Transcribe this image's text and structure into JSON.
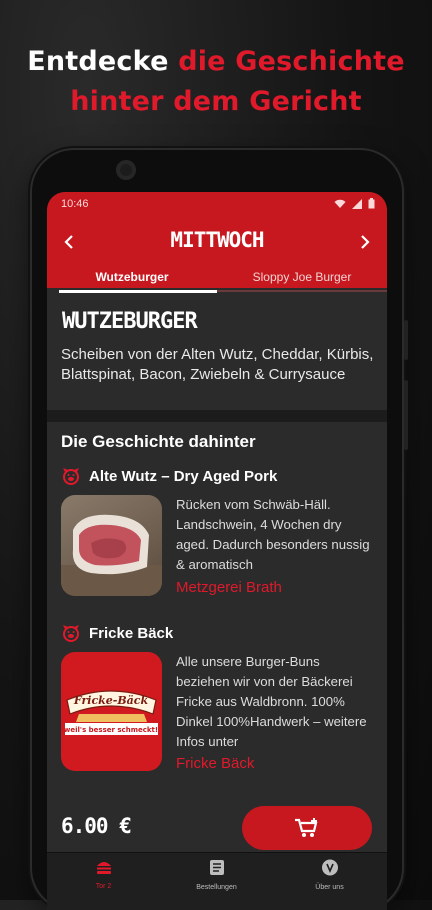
{
  "headline": {
    "part1": "Entdecke ",
    "part2": "die Geschichte",
    "part3": "hinter dem Gericht"
  },
  "status": {
    "time": "10:46"
  },
  "day_title": "MITTWOCH",
  "tabs": [
    {
      "label": "Wutzeburger",
      "active": true
    },
    {
      "label": "Sloppy Joe Burger",
      "active": false
    }
  ],
  "burger": {
    "title": "WUTZEBURGER",
    "description": "Scheiben von der Alten Wutz, Cheddar, Kürbis, Blattspinat, Bacon, Zwiebeln & Currysauce"
  },
  "story": {
    "section_title": "Die Geschichte dahinter",
    "items": [
      {
        "title": "Alte Wutz – Dry Aged Pork",
        "text": "Rücken vom Schwäb-Häll. Landschwein, 4 Wochen dry aged. Dadurch besonders nussig & aromatisch",
        "link": "Metzgerei Brath",
        "icon": "pig-icon"
      },
      {
        "title": "Fricke Bäck",
        "text": "Alle unsere Burger-Buns beziehen wir von der Bäckerei Fricke aus Waldbronn. 100% Dinkel 100%Handwerk – weitere Infos unter",
        "link": "Fricke Bäck",
        "icon": "pig-icon",
        "logo": {
          "name": "Fricke-Bäck",
          "slogan": "weil's besser schmeckt!"
        }
      }
    ]
  },
  "price": "6.00 €",
  "cart_icon": "add-to-cart-icon",
  "bottom_nav": [
    {
      "label": "Tor 2",
      "icon": "burger-icon",
      "active": true
    },
    {
      "label": "Bestellungen",
      "icon": "list-icon",
      "active": false
    },
    {
      "label": "Über uns",
      "icon": "info-icon",
      "active": false
    }
  ],
  "colors": {
    "brand_red": "#c8181f",
    "accent_red": "#e0192b",
    "background": "#2b2b2b"
  }
}
